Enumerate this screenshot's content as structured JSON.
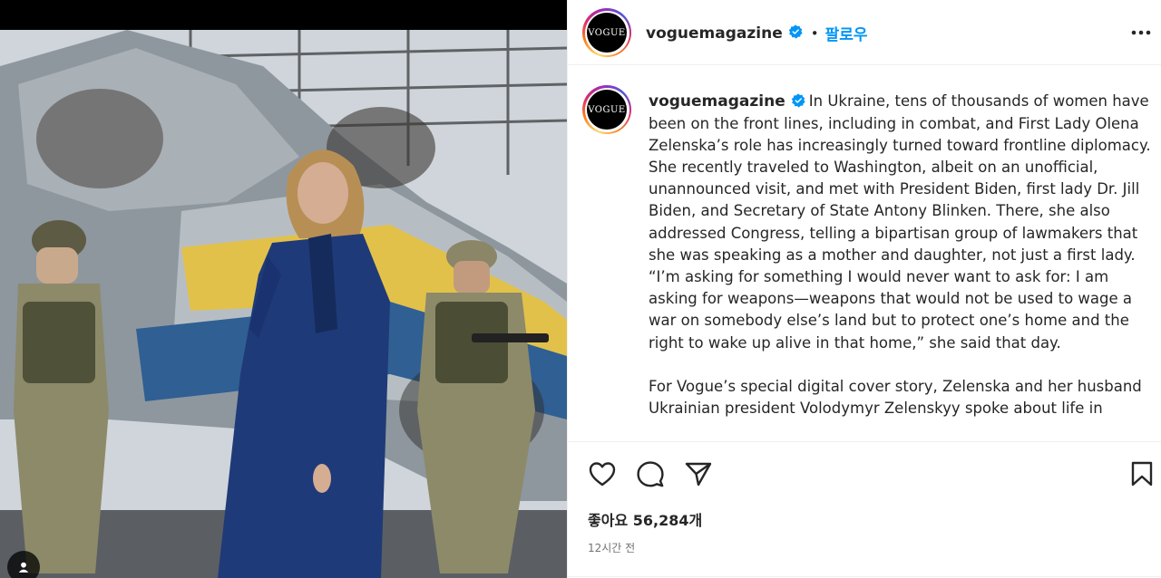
{
  "post": {
    "username": "voguemagazine",
    "avatar_text": "VOGUE",
    "follow_label": "팔로우",
    "separator": "•",
    "verified_color": "#0095f6",
    "caption_paragraphs": [
      "In Ukraine, tens of thousands of women have been on the front lines, including in combat, and First Lady Olena Zelenska’s role has increasingly turned toward frontline diplomacy. She recently traveled to Washington, albeit on an unofficial, unannounced visit, and met with President Biden, first lady Dr. Jill Biden, and Secretary of State Antony Blinken. There, she also addressed Congress, telling a bipartisan group of lawmakers that she was speaking as a mother and daughter, not just a first lady. “I’m asking for something I would never want to ask for: I am asking for weapons—weapons that would not be used to wage a war on somebody else’s land but to protect one’s home and the right to wake up alive in that home,” she said that day.",
      "For Vogue’s special digital cover story, Zelenska and her husband Ukrainian president Volodymyr Zelenskyy spoke about life in"
    ],
    "likes_label": "좋아요",
    "likes_count": "56,284개",
    "timestamp": "12시간 전"
  },
  "icons": {
    "more": "more-options-icon",
    "like": "heart-icon",
    "comment": "comment-icon",
    "share": "paper-plane-icon",
    "save": "bookmark-icon",
    "verified": "verified-badge-icon",
    "media_indicator": "tagged-users-icon"
  },
  "colors": {
    "link": "#0095f6",
    "text": "#262626",
    "secondary": "#737373",
    "divider": "#efefef"
  }
}
